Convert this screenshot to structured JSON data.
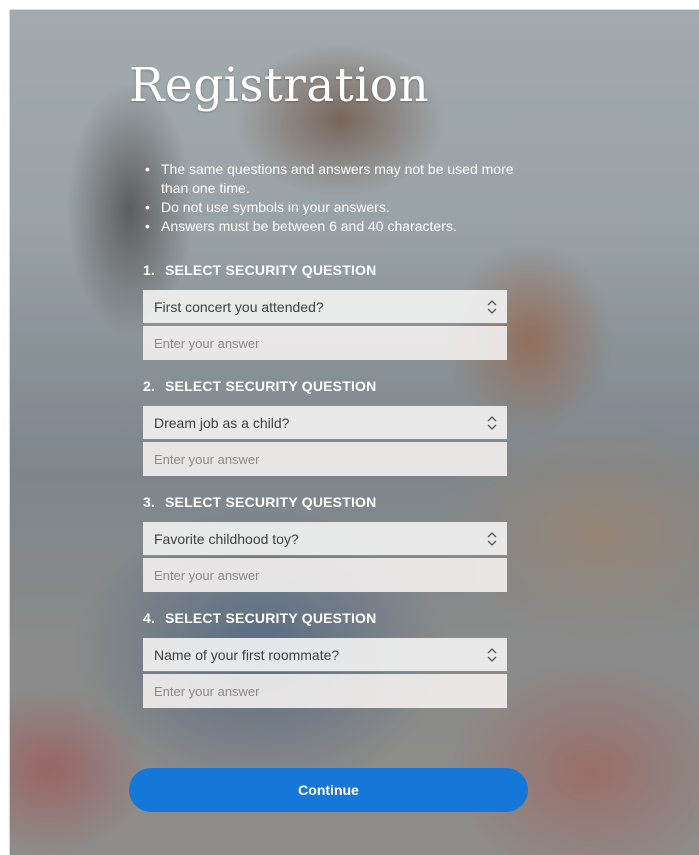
{
  "page": {
    "title": "Registration",
    "rules": [
      "The same questions and answers may not be used more than one time.",
      "Do not use symbols in your answers.",
      "Answers must be between 6 and 40 characters."
    ]
  },
  "questions": [
    {
      "number": "1.",
      "heading": "SELECT SECURITY QUESTION",
      "selected": "First concert you attended?",
      "answer_placeholder": "Enter your answer"
    },
    {
      "number": "2.",
      "heading": "SELECT SECURITY QUESTION",
      "selected": "Dream job as a child?",
      "answer_placeholder": "Enter your answer"
    },
    {
      "number": "3.",
      "heading": "SELECT SECURITY QUESTION",
      "selected": "Favorite childhood toy?",
      "answer_placeholder": "Enter your answer"
    },
    {
      "number": "4.",
      "heading": "SELECT SECURITY QUESTION",
      "selected": "Name of your first roommate?",
      "answer_placeholder": "Enter your answer"
    }
  ],
  "actions": {
    "continue_label": "Continue"
  },
  "colors": {
    "accent": "#1578d8",
    "text_on_photo": "#ffffff"
  },
  "icons": {
    "select_chevron": "chevron-up-down-icon"
  }
}
